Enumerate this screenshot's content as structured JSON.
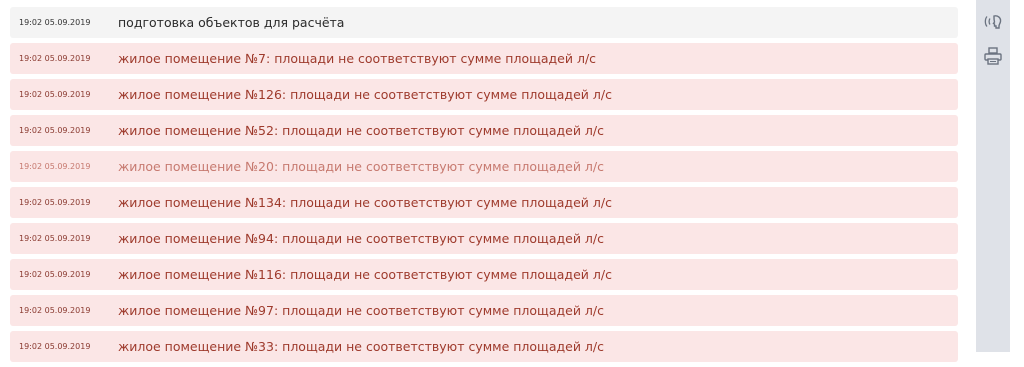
{
  "log": {
    "rows": [
      {
        "time": "19:02 05.09.2019",
        "text": "подготовка объектов для расчёта",
        "kind": "info"
      },
      {
        "time": "19:02 05.09.2019",
        "text": "жилое помещение №7: площади не соответствуют сумме площадей л/с",
        "kind": "error"
      },
      {
        "time": "19:02 05.09.2019",
        "text": "жилое помещение №126: площади не соответствуют сумме площадей л/с",
        "kind": "error"
      },
      {
        "time": "19:02 05.09.2019",
        "text": "жилое помещение №52: площади не соответствуют сумме площадей л/с",
        "kind": "error"
      },
      {
        "time": "19:02 05.09.2019",
        "text": "жилое помещение №20: площади не соответствуют сумме площадей л/с",
        "kind": "error-faded"
      },
      {
        "time": "19:02 05.09.2019",
        "text": "жилое помещение №134: площади не соответствуют сумме площадей л/с",
        "kind": "error"
      },
      {
        "time": "19:02 05.09.2019",
        "text": "жилое помещение №94: площади не соответствуют сумме площадей л/с",
        "kind": "error"
      },
      {
        "time": "19:02 05.09.2019",
        "text": "жилое помещение №116: площади не соответствуют сумме площадей л/с",
        "kind": "error"
      },
      {
        "time": "19:02 05.09.2019",
        "text": "жилое помещение №97: площади не соответствуют сумме площадей л/с",
        "kind": "error"
      },
      {
        "time": "19:02 05.09.2019",
        "text": "жилое помещение №33: площади не соответствуют сумме площадей л/с",
        "kind": "error"
      }
    ]
  },
  "side_panel": {
    "buttons": [
      {
        "icon": "speaking-head-icon"
      },
      {
        "icon": "printer-icon"
      }
    ]
  },
  "colors": {
    "error_row_bg": "#fbe6e6",
    "info_row_bg": "#f4f4f4",
    "error_text": "#9e3a2c",
    "panel_bg": "#dfe2e8"
  }
}
